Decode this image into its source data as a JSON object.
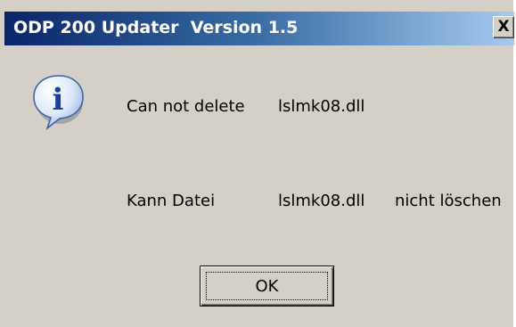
{
  "dialog": {
    "title": "ODP 200 Updater  Version 1.5",
    "close_symbol": "X",
    "icon": "info-icon",
    "icon_letter": "i",
    "messages": {
      "line1_prefix": "Can not delete",
      "line1_file": "lslmk08.dll",
      "line2_prefix": "Kann Datei",
      "line2_file": "lslmk08.dll",
      "line2_suffix": "nicht löschen"
    },
    "ok_label": "OK"
  },
  "colors": {
    "titlebar_start": "#0a246a",
    "titlebar_end": "#a6caf0",
    "face": "#d4d0c8"
  }
}
